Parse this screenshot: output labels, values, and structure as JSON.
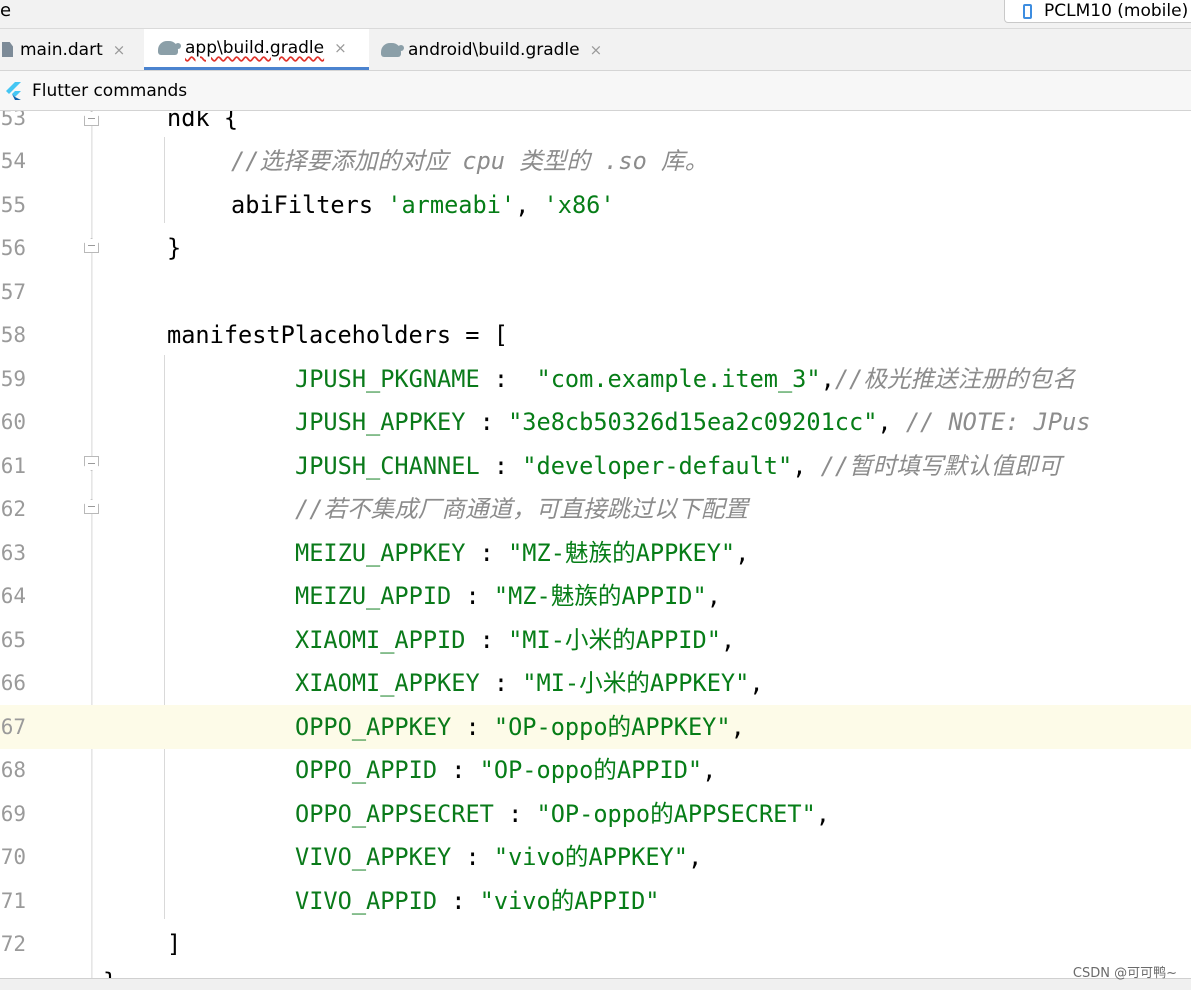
{
  "topbar": {
    "left_text": "e",
    "device_label": "PCLM10 (mobile)"
  },
  "tabs": [
    {
      "label": "main.dart",
      "icon": "dart-file-icon"
    },
    {
      "label": "app\\build.gradle",
      "icon": "gradle-icon",
      "active": true
    },
    {
      "label": "android\\build.gradle",
      "icon": "gradle-icon"
    }
  ],
  "close_glyph": "×",
  "commands": {
    "label": "Flutter commands",
    "icon": "flutter-icon"
  },
  "editor": {
    "current_line": "67",
    "line_numbers": [
      "53",
      "54",
      "55",
      "56",
      "57",
      "58",
      "59",
      "60",
      "61",
      "62",
      "63",
      "64",
      "65",
      "66",
      "67",
      "68",
      "69",
      "70",
      "71",
      "72"
    ],
    "lines": {
      "l53": {
        "text": "ndk {"
      },
      "l54": {
        "comment": "//选择要添加的对应 cpu 类型的 .so 库。"
      },
      "l55": {
        "plain": "abiFilters ",
        "s1": "'armeabi'",
        "sep": ", ",
        "s2": "'x86'"
      },
      "l56": {
        "text": "}"
      },
      "l58": {
        "text": "manifestPlaceholders = ["
      },
      "l59": {
        "key": "JPUSH_PKGNAME",
        "sep": " :  ",
        "value": "\"com.example.item_3\"",
        "tail": ",",
        "comment": "//极光推送注册的包名"
      },
      "l60": {
        "key": "JPUSH_APPKEY",
        "sep": " : ",
        "value": "\"3e8cb50326d15ea2c09201cc\"",
        "tail": ", ",
        "comment": "// NOTE: JPus"
      },
      "l61": {
        "key": "JPUSH_CHANNEL",
        "sep": " : ",
        "value": "\"developer-default\"",
        "tail": ", ",
        "comment": "//暂时填写默认值即可"
      },
      "l62": {
        "comment": "//若不集成厂商通道，可直接跳过以下配置"
      },
      "l63": {
        "key": "MEIZU_APPKEY",
        "sep": " : ",
        "value": "\"MZ-魅族的APPKEY\"",
        "tail": ","
      },
      "l64": {
        "key": "MEIZU_APPID",
        "sep": " : ",
        "value": "\"MZ-魅族的APPID\"",
        "tail": ","
      },
      "l65": {
        "key": "XIAOMI_APPID",
        "sep": " : ",
        "value": "\"MI-小米的APPID\"",
        "tail": ","
      },
      "l66": {
        "key": "XIAOMI_APPKEY",
        "sep": " : ",
        "value": "\"MI-小米的APPKEY\"",
        "tail": ","
      },
      "l67": {
        "key": "OPPO_APPKEY",
        "sep": " : ",
        "value": "\"OP-oppo的APPKEY\"",
        "tail": ","
      },
      "l68": {
        "key": "OPPO_APPID",
        "sep": " : ",
        "value": "\"OP-oppo的APPID\"",
        "tail": ","
      },
      "l69": {
        "key": "OPPO_APPSECRET",
        "sep": " : ",
        "value": "\"OP-oppo的APPSECRET\"",
        "tail": ","
      },
      "l70": {
        "key": "VIVO_APPKEY",
        "sep": " : ",
        "value": "\"vivo的APPKEY\"",
        "tail": ","
      },
      "l71": {
        "key": "VIVO_APPID",
        "sep": " : ",
        "value": "\"vivo的APPID\"",
        "tail": ""
      },
      "l72": {
        "text": "]"
      },
      "l73": {
        "text": "}"
      }
    }
  },
  "watermark": "CSDN @可可鸭~",
  "colors": {
    "string": "#067d17",
    "comment": "#8c8c8c",
    "active_tab_underline": "#4b83cf",
    "current_line_bg": "#fdfbe8"
  }
}
